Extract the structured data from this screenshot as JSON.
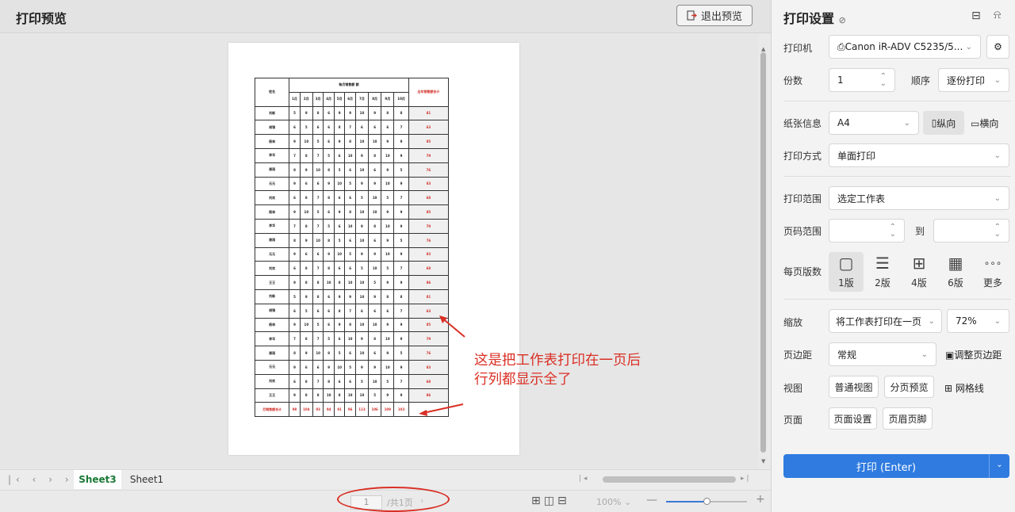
{
  "preview": {
    "title": "打印预览",
    "exit_label": "退出预览"
  },
  "sheet": {
    "header_col": "姓名",
    "header_group": "每月销售额 额",
    "header_total": "全年销售额合计",
    "months": [
      "1月",
      "2月",
      "3月",
      "4月",
      "5月",
      "6月",
      "7月",
      "8月",
      "9月",
      "10月"
    ],
    "rows": [
      [
        "刘新",
        5,
        9,
        8,
        6,
        9,
        9,
        10,
        9,
        8,
        8,
        81
      ],
      [
        "胡锦",
        6,
        5,
        6,
        6,
        8,
        7,
        6,
        6,
        6,
        7,
        63
      ],
      [
        "杨林",
        9,
        10,
        5,
        6,
        9,
        8,
        10,
        10,
        9,
        9,
        85
      ],
      [
        "李华",
        7,
        8,
        7,
        5,
        6,
        10,
        9,
        8,
        10,
        9,
        79
      ],
      [
        "周雨",
        8,
        9,
        10,
        8,
        5,
        6,
        10,
        6,
        9,
        5,
        76
      ],
      [
        "元元",
        9,
        6,
        6,
        9,
        10,
        5,
        9,
        9,
        10,
        9,
        83
      ],
      [
        "刘欢",
        6,
        8,
        7,
        8,
        6,
        6,
        5,
        10,
        5,
        7,
        68
      ],
      [
        "杨林",
        9,
        10,
        5,
        6,
        9,
        8,
        10,
        10,
        9,
        9,
        85
      ],
      [
        "李华",
        7,
        8,
        7,
        5,
        6,
        10,
        9,
        8,
        10,
        9,
        79
      ],
      [
        "周雨",
        8,
        9,
        10,
        8,
        5,
        6,
        10,
        6,
        9,
        5,
        76
      ],
      [
        "元元",
        9,
        6,
        6,
        9,
        10,
        5,
        9,
        9,
        10,
        9,
        83
      ],
      [
        "刘欢",
        6,
        8,
        7,
        8,
        6,
        6,
        5,
        10,
        5,
        7,
        68
      ],
      [
        "王王",
        9,
        8,
        8,
        10,
        8,
        10,
        10,
        5,
        9,
        9,
        86
      ],
      [
        "刘新",
        5,
        9,
        8,
        6,
        9,
        9,
        10,
        9,
        8,
        8,
        81
      ],
      [
        "胡锦",
        6,
        5,
        6,
        6,
        8,
        7,
        6,
        6,
        6,
        7,
        63
      ],
      [
        "杨林",
        9,
        10,
        5,
        6,
        9,
        8,
        10,
        10,
        9,
        9,
        85
      ],
      [
        "李华",
        7,
        8,
        7,
        5,
        6,
        10,
        9,
        8,
        10,
        9,
        79
      ],
      [
        "周雨",
        8,
        9,
        10,
        8,
        5,
        6,
        10,
        6,
        9,
        5,
        76
      ],
      [
        "元元",
        9,
        6,
        6,
        9,
        10,
        5,
        9,
        9,
        10,
        9,
        83
      ],
      [
        "刘欢",
        6,
        8,
        7,
        8,
        6,
        6,
        5,
        10,
        5,
        7,
        68
      ],
      [
        "王王",
        9,
        8,
        8,
        10,
        8,
        10,
        10,
        5,
        9,
        9,
        86
      ]
    ],
    "footer": [
      "月销售额合计",
      98,
      104,
      93,
      94,
      91,
      96,
      113,
      106,
      109,
      103
    ]
  },
  "annotation": {
    "line1": "这是把工作表打印在一页后",
    "line2": "行列都显示全了"
  },
  "tabs": [
    "Sheet3",
    "Sheet1"
  ],
  "status": {
    "page_current": "1",
    "page_total": "/共1页",
    "zoom": "100%"
  },
  "panel": {
    "title": "打印设置",
    "printer_label": "打印机",
    "printer_value": "Canon iR-ADV C5235/5...",
    "copies_label": "份数",
    "copies_value": "1",
    "order_label": "顺序",
    "order_value": "逐份打印",
    "paper_label": "纸张信息",
    "paper_value": "A4",
    "portrait": "纵向",
    "landscape": "横向",
    "mode_label": "打印方式",
    "mode_value": "单面打印",
    "range_label": "打印范围",
    "range_value": "选定工作表",
    "pages_label": "页码范围",
    "pages_to": "到",
    "per_page_label": "每页版数",
    "layouts": [
      "1版",
      "2版",
      "4版",
      "6版",
      "更多"
    ],
    "scale_label": "缩放",
    "scale_value": "将工作表打印在一页",
    "scale_pct": "72%",
    "margin_label": "页边距",
    "margin_value": "常规",
    "margin_adjust": "调整页边距",
    "view_label": "视图",
    "view_normal": "普通视图",
    "view_pagebreak": "分页预览",
    "gridlines": "网格线",
    "page_label": "页面",
    "page_setup": "页面设置",
    "header_footer": "页眉页脚",
    "print_button": "打印 (Enter)"
  },
  "colors": {
    "accent": "#2f7be0",
    "annotation": "#d93025",
    "sheet_tab": "#1a7a36"
  }
}
